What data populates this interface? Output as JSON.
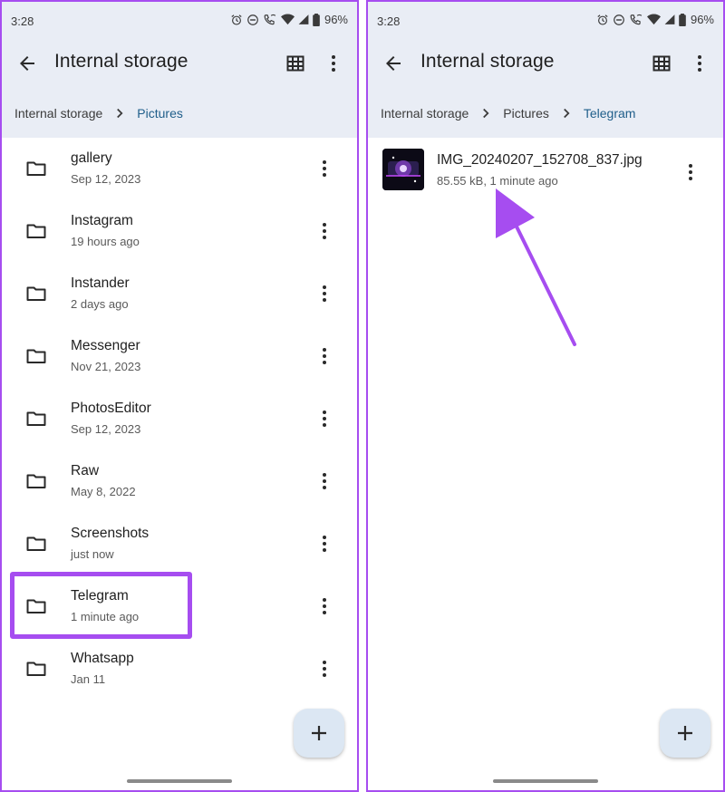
{
  "left": {
    "status": {
      "time": "3:28",
      "battery": "96%"
    },
    "title": "Internal storage",
    "breadcrumb": [
      "Internal storage",
      "Pictures"
    ],
    "folders": [
      {
        "name": "gallery",
        "date": "Sep 12, 2023"
      },
      {
        "name": "Instagram",
        "date": "19 hours ago"
      },
      {
        "name": "Instander",
        "date": "2 days ago"
      },
      {
        "name": "Messenger",
        "date": "Nov 21, 2023"
      },
      {
        "name": "PhotosEditor",
        "date": "Sep 12, 2023"
      },
      {
        "name": "Raw",
        "date": "May 8, 2022"
      },
      {
        "name": "Screenshots",
        "date": "just now"
      },
      {
        "name": "Telegram",
        "date": "1 minute ago"
      },
      {
        "name": "Whatsapp",
        "date": "Jan 11"
      }
    ],
    "highlighted_folder": "Telegram"
  },
  "right": {
    "status": {
      "time": "3:28",
      "battery": "96%"
    },
    "title": "Internal storage",
    "breadcrumb": [
      "Internal storage",
      "Pictures",
      "Telegram"
    ],
    "file": {
      "name": "IMG_20240207_152708_837.jpg",
      "meta": "85.55 kB, 1 minute ago"
    }
  },
  "icons": {
    "back": "arrow-back-icon",
    "grid": "grid-view-icon",
    "more": "more-vert-icon",
    "folder": "folder-icon",
    "chevron": "chevron-right-icon",
    "add": "plus-icon",
    "status": [
      "alarm-icon",
      "do-not-disturb-icon",
      "wifi-calling-icon",
      "wifi-icon",
      "signal-icon",
      "battery-icon"
    ]
  },
  "colors": {
    "accent_highlight": "#a64df0",
    "header_background": "#e9edf5",
    "breadcrumb_active": "#1f5e8a",
    "fab_background": "#dce7f3"
  }
}
